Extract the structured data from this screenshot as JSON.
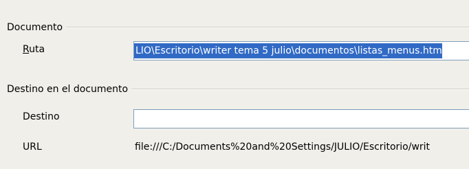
{
  "documento": {
    "section_title": "Documento",
    "ruta_label_mnemonic": "R",
    "ruta_label_rest": "uta",
    "ruta_value": "LIO\\Escritorio\\writer tema 5 julio\\documentos\\listas_menus.htm"
  },
  "destino_section": {
    "section_title": "Destino en el documento",
    "destino_label": "Destino",
    "destino_value": "",
    "url_label": "URL",
    "url_value": "file:///C:/Documents%20and%20Settings/JULIO/Escritorio/writ"
  }
}
